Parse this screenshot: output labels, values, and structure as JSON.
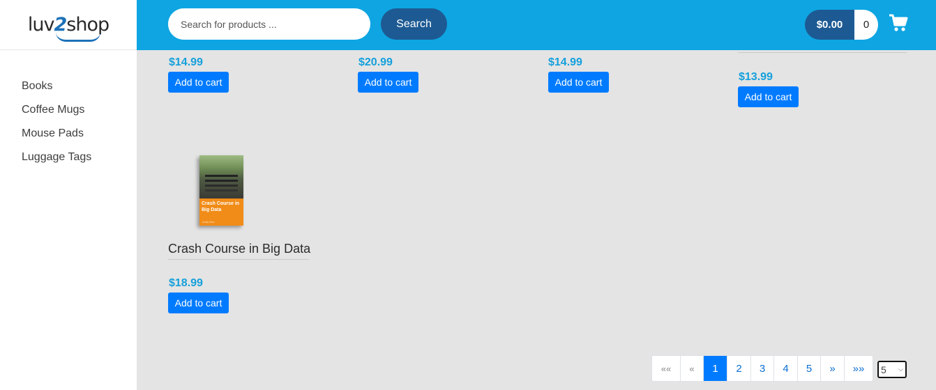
{
  "brand": {
    "logo_prefix": "luv",
    "logo_two": "2",
    "logo_suffix": "shop"
  },
  "sidebar": {
    "categories": [
      "Books",
      "Coffee Mugs",
      "Mouse Pads",
      "Luggage Tags"
    ]
  },
  "header": {
    "search_placeholder": "Search for products ...",
    "search_label": "Search",
    "cart_total": "$0.00",
    "cart_quantity": "0"
  },
  "products": [
    {
      "title": "",
      "price": "$14.99",
      "button": "Add to cart"
    },
    {
      "title": "",
      "price": "$20.99",
      "button": "Add to cart"
    },
    {
      "title": "",
      "price": "$14.99",
      "button": "Add to cart"
    },
    {
      "title": "",
      "price": "$13.99",
      "button": "Add to cart"
    },
    {
      "title": "Crash Course in Big Data",
      "price": "$18.99",
      "button": "Add to cart",
      "cover_title": "Crash Course in Big Data",
      "cover_author": "Andy Burr"
    }
  ],
  "pagination": {
    "first": "««",
    "prev": "«",
    "pages": [
      "1",
      "2",
      "3",
      "4",
      "5"
    ],
    "active_page": "1",
    "next": "»",
    "last": "»»",
    "page_size": "5"
  },
  "colors": {
    "header": "#0ea5e2",
    "dark_blue": "#1d5a93",
    "price": "#14a0dc",
    "button": "#007bff"
  }
}
